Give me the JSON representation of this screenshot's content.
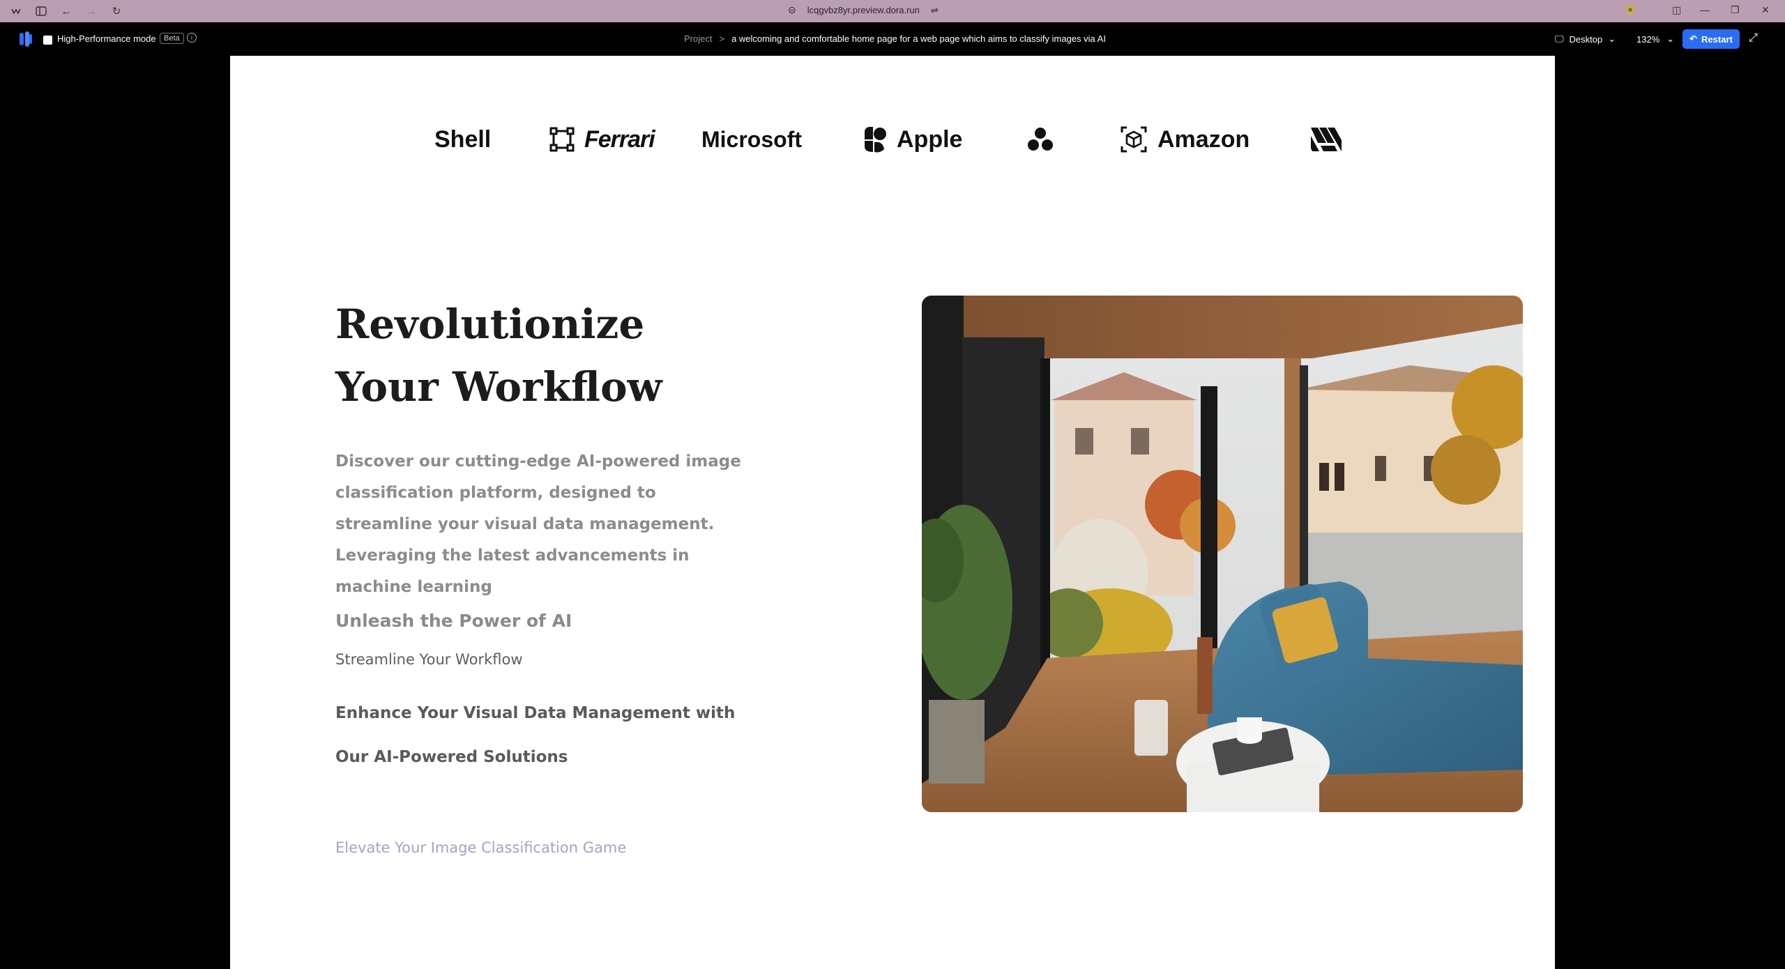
{
  "browser": {
    "url": "lcqgvbz8yr.preview.dora.run"
  },
  "toolbar": {
    "high_performance_label": "High-Performance mode",
    "beta_label": "Beta",
    "breadcrumb_project": "Project",
    "breadcrumb_separator": ">",
    "breadcrumb_page": "a welcoming and comfortable home page for a web page which aims to classify images via AI",
    "device_label": "Desktop",
    "zoom_label": "132%",
    "restart_label": "Restart"
  },
  "logos": [
    {
      "name": "Shell",
      "icon": "none"
    },
    {
      "name": "Ferrari",
      "icon": "frame-icon"
    },
    {
      "name": "Microsoft",
      "icon": "none"
    },
    {
      "name": "Apple",
      "icon": "blob-icon"
    },
    {
      "name": "",
      "icon": "three-dots-icon"
    },
    {
      "name": "Amazon",
      "icon": "cube-icon"
    },
    {
      "name": "",
      "icon": "wave-mark-icon"
    }
  ],
  "hero": {
    "title_line1": "Revolutionize",
    "title_line2": "Your Workflow",
    "description": "Discover our cutting-edge AI-powered image classification platform, designed to streamline your visual data management. Leveraging the latest advancements in machine learning",
    "subheading": "Unleash the Power of AI",
    "tagline": "Streamline Your Workflow",
    "feature_text": "Enhance Your Visual Data Management with Our AI-Powered Solutions",
    "link_text": "Elevate Your Image Classification Game"
  },
  "colors": {
    "chrome_bg": "#b99fb1",
    "accent": "#2a6df4",
    "link_color": "#a7a2c4"
  }
}
